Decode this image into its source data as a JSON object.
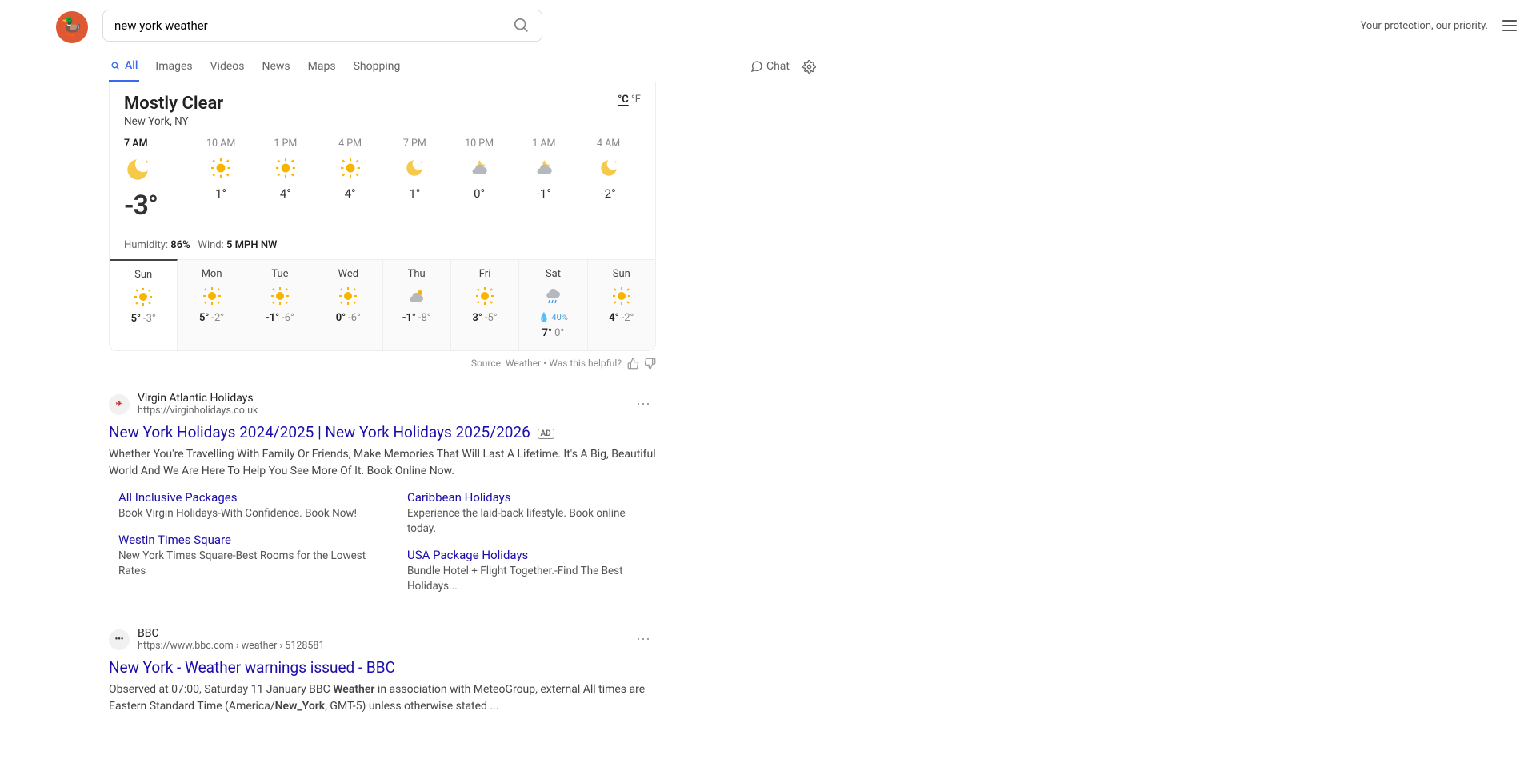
{
  "search": {
    "query": "new york weather"
  },
  "tagline": "Your protection, our priority.",
  "nav": {
    "all": "All",
    "images": "Images",
    "videos": "Videos",
    "news": "News",
    "maps": "Maps",
    "shopping": "Shopping",
    "chat": "Chat"
  },
  "weather": {
    "condition": "Mostly Clear",
    "location": "New York, NY",
    "unit_c": "°C",
    "unit_f": "°F",
    "hourly": [
      {
        "time": "7 AM",
        "icon": "moon",
        "temp": "-3°"
      },
      {
        "time": "10 AM",
        "icon": "sun",
        "temp": "1°"
      },
      {
        "time": "1 PM",
        "icon": "sun",
        "temp": "4°"
      },
      {
        "time": "4 PM",
        "icon": "sun",
        "temp": "4°"
      },
      {
        "time": "7 PM",
        "icon": "moon",
        "temp": "1°"
      },
      {
        "time": "10 PM",
        "icon": "cloud-moon",
        "temp": "0°"
      },
      {
        "time": "1 AM",
        "icon": "cloud-moon",
        "temp": "-1°"
      },
      {
        "time": "4 AM",
        "icon": "moon",
        "temp": "-2°"
      }
    ],
    "humidity_label": "Humidity:",
    "humidity": "86%",
    "wind_label": "Wind:",
    "wind": "5 MPH NW",
    "daily": [
      {
        "day": "Sun",
        "icon": "sun",
        "hi": "5°",
        "lo": "-3°",
        "selected": true
      },
      {
        "day": "Mon",
        "icon": "sun",
        "hi": "5°",
        "lo": "-2°"
      },
      {
        "day": "Tue",
        "icon": "sun",
        "hi": "-1°",
        "lo": "-6°"
      },
      {
        "day": "Wed",
        "icon": "sun",
        "hi": "0°",
        "lo": "-6°"
      },
      {
        "day": "Thu",
        "icon": "cloud-sun",
        "hi": "-1°",
        "lo": "-8°"
      },
      {
        "day": "Fri",
        "icon": "sun",
        "hi": "3°",
        "lo": "-5°"
      },
      {
        "day": "Sat",
        "icon": "rain",
        "rain": "40%",
        "hi": "7°",
        "lo": "0°"
      },
      {
        "day": "Sun",
        "icon": "sun",
        "hi": "4°",
        "lo": "-2°"
      }
    ],
    "source_prefix": "Source:",
    "source_name": "Weather",
    "helpful": "Was this helpful?"
  },
  "results": [
    {
      "site": "Virgin Atlantic Holidays",
      "url": "https://virginholidays.co.uk",
      "favicon": "va",
      "title": "New York Holidays 2024/2025 | New York Holidays 2025/2026",
      "ad": true,
      "desc": "Whether You're Travelling With Family Or Friends, Make Memories That Will Last A Lifetime. It's A Big, Beautiful World And We Are Here To Help You See More Of It. Book Online Now.",
      "sitelinks_left": [
        {
          "title": "All Inclusive Packages",
          "desc": "Book Virgin Holidays-With Confidence. Book Now!"
        },
        {
          "title": "Westin Times Square",
          "desc": "New York Times Square-Best Rooms for the Lowest Rates"
        }
      ],
      "sitelinks_right": [
        {
          "title": "Caribbean Holidays",
          "desc": "Experience the laid-back lifestyle. Book online today."
        },
        {
          "title": "USA Package Holidays",
          "desc": "Bundle Hotel + Flight Together.-Find The Best Holidays..."
        }
      ]
    },
    {
      "site": "BBC",
      "url": "https://www.bbc.com › weather › 5128581",
      "favicon": "bbc",
      "title": "New York - Weather warnings issued - BBC",
      "desc_html": "Observed at 07:00, Saturday 11 January BBC <b>Weather</b> in association with MeteoGroup, external All times are Eastern Standard Time (America/<b>New_York</b>, GMT-5) unless otherwise stated ..."
    }
  ],
  "ad_badge": "AD"
}
